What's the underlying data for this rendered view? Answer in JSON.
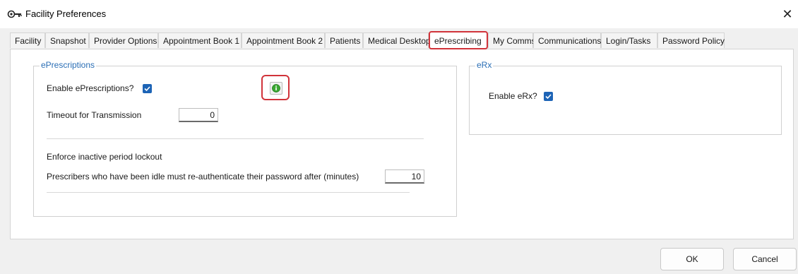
{
  "window": {
    "title": "Facility Preferences",
    "close_glyph": "✕",
    "icon": "key-icon"
  },
  "tabs": [
    {
      "label": "Facility",
      "active": false
    },
    {
      "label": "Snapshot",
      "active": false
    },
    {
      "label": "Provider Options",
      "active": false
    },
    {
      "label": "Appointment Book 1",
      "active": false
    },
    {
      "label": "Appointment Book 2",
      "active": false
    },
    {
      "label": "Patients",
      "active": false
    },
    {
      "label": "Medical Desktop",
      "active": false
    },
    {
      "label": "ePrescribing",
      "active": true
    },
    {
      "label": "My Comms",
      "active": false
    },
    {
      "label": "Communications",
      "active": false
    },
    {
      "label": "Login/Tasks",
      "active": false
    },
    {
      "label": "Password Policy",
      "active": false
    }
  ],
  "eprescriptions": {
    "group_title": "ePrescriptions",
    "enable_label": "Enable ePrescriptions?",
    "enable_checked": true,
    "info_icon": "green-info-icon",
    "timeout_label": "Timeout for Transmission",
    "timeout_value": "0",
    "enforce_label": "Enforce inactive period lockout",
    "idle_label": "Prescribers who have been idle must re-authenticate their password after (minutes)",
    "idle_value": "10"
  },
  "erx": {
    "group_title": "eRx",
    "enable_label": "Enable eRx?",
    "enable_checked": true
  },
  "footer": {
    "ok_label": "OK",
    "cancel_label": "Cancel"
  },
  "colors": {
    "accent": "#1d64b6",
    "highlight": "#d1333a",
    "group_title": "#2a6eb5"
  }
}
